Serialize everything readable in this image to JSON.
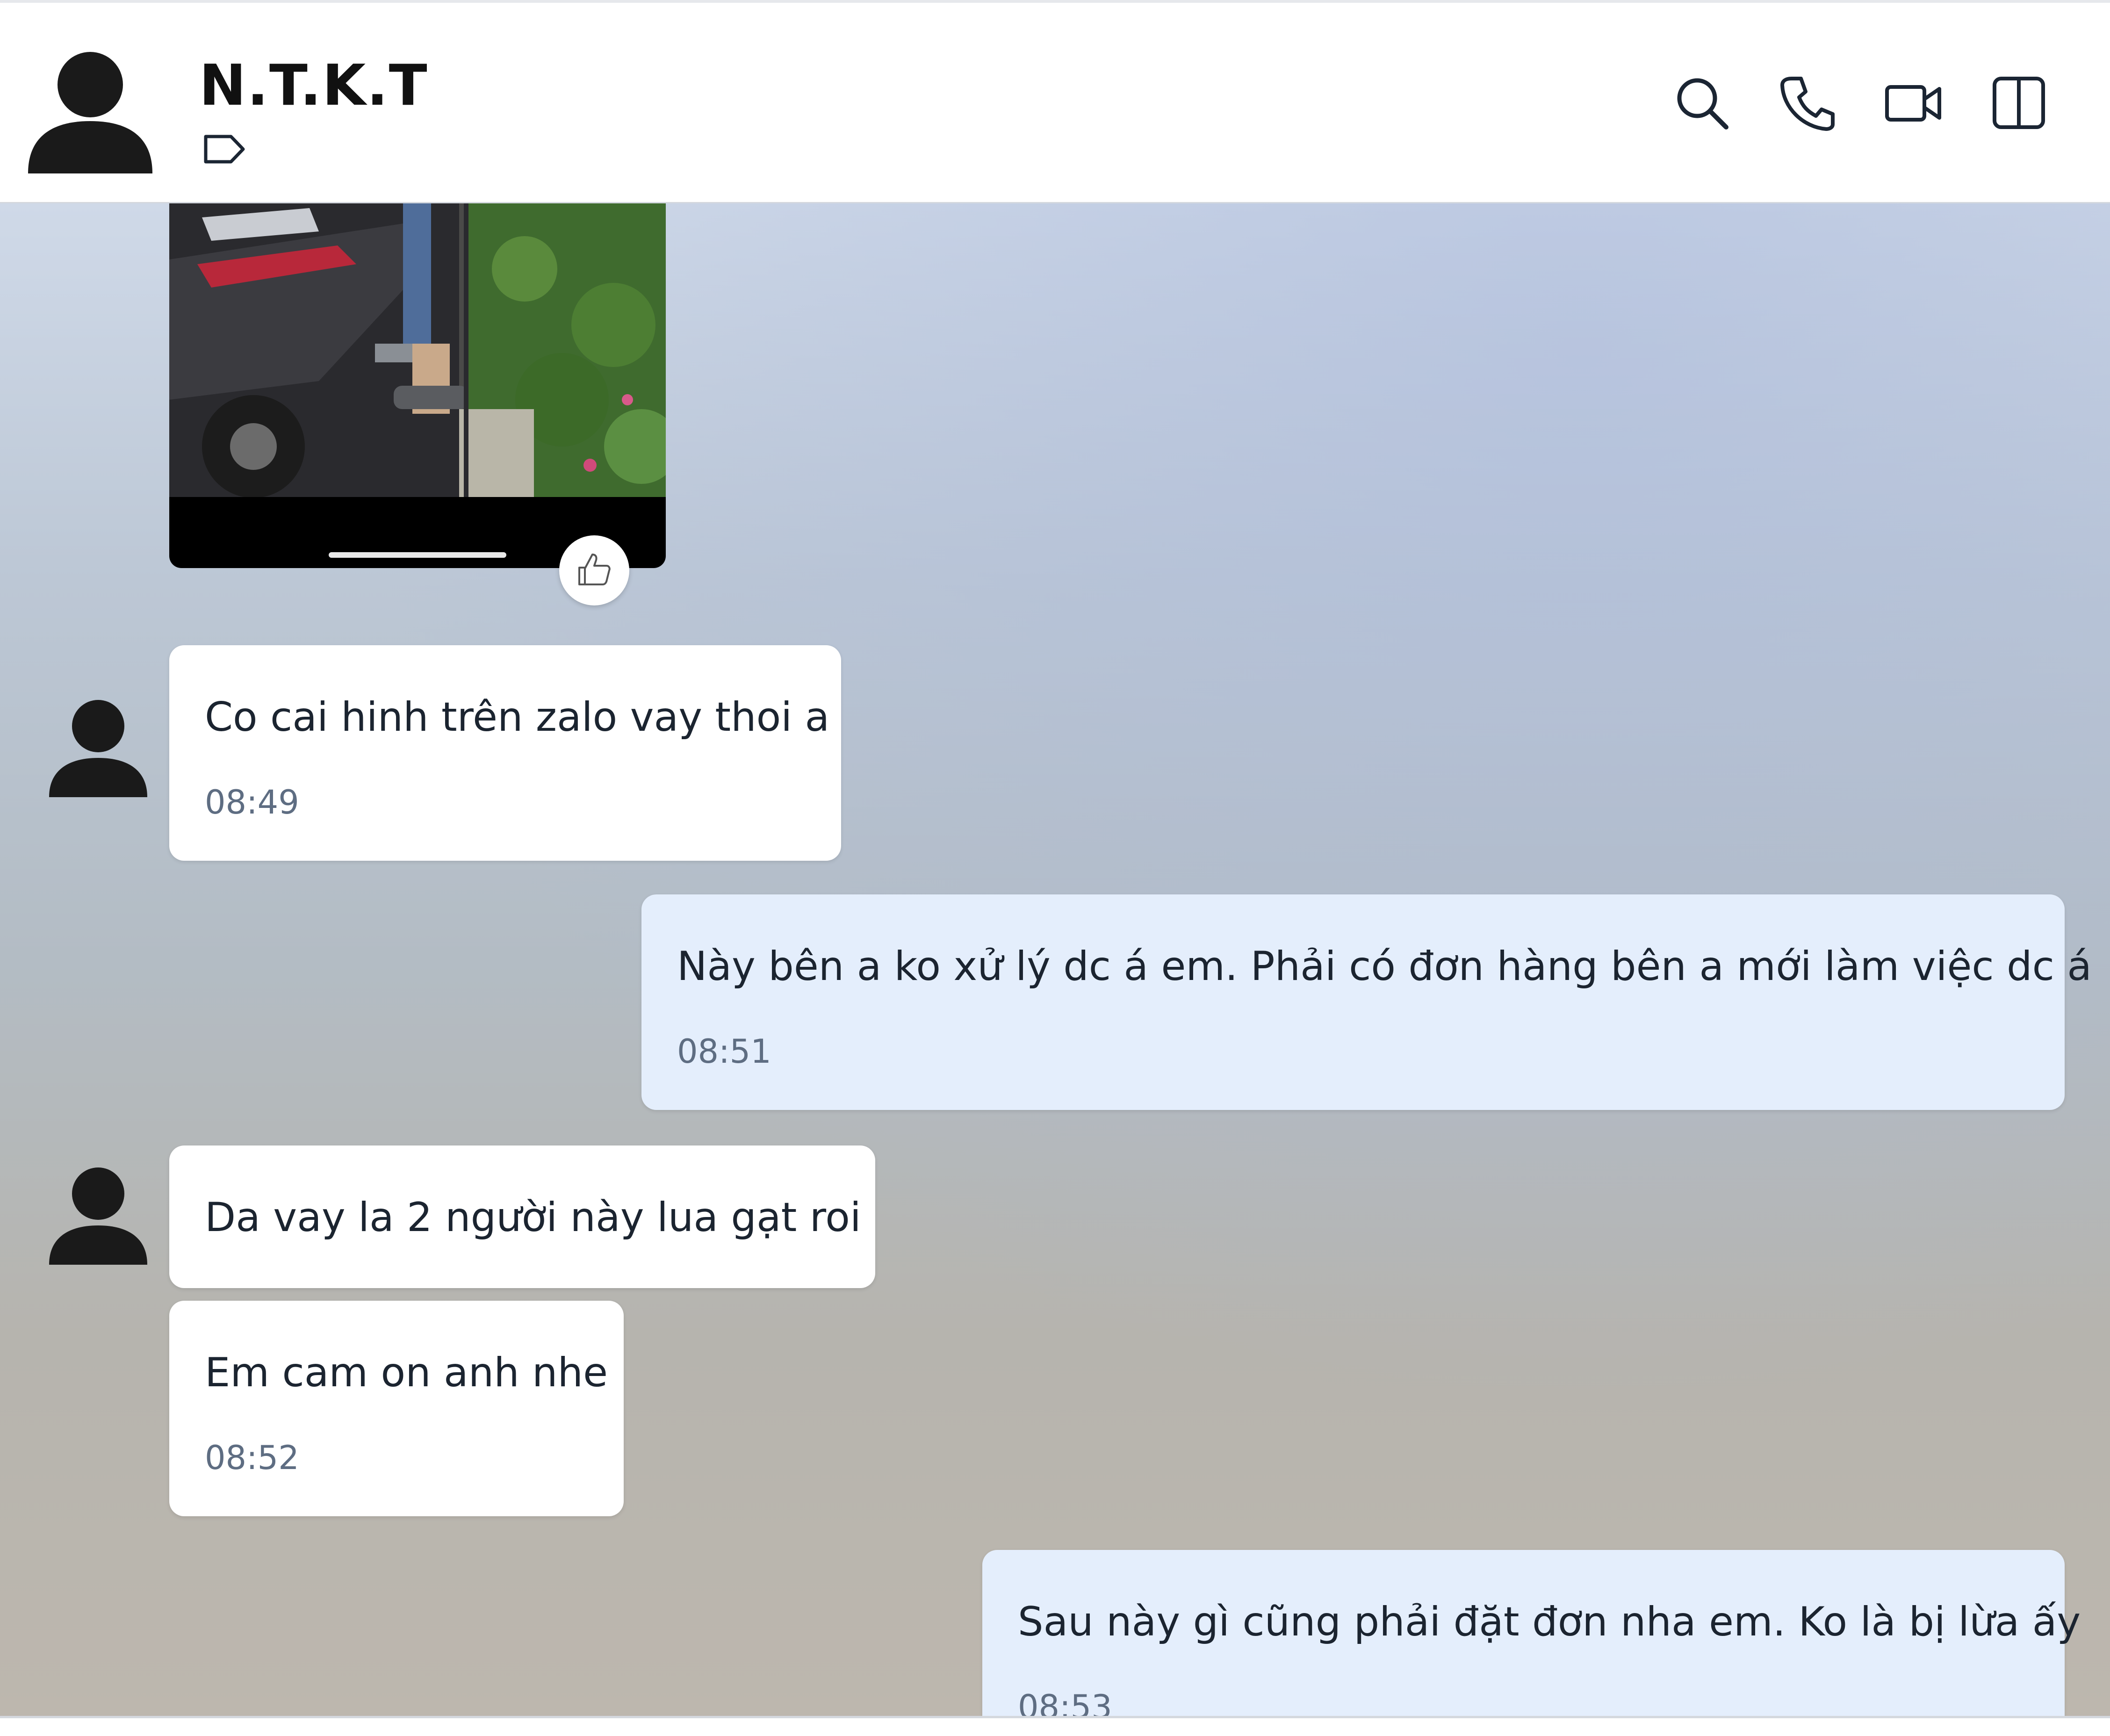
{
  "header": {
    "contact_name": "N.T.K.T",
    "icons": [
      "avatar-icon",
      "tag-icon",
      "search-icon",
      "phone-icon",
      "video-call-icon",
      "sidebar-toggle-icon"
    ]
  },
  "messages": [
    {
      "direction": "incoming",
      "text": "Co cai hinh trên zalo vay thoi a",
      "time": "08:49"
    },
    {
      "direction": "outgoing",
      "text": "Này bên a ko xử lý dc á em. Phải có đơn hàng bên a mới làm việc dc á",
      "time": "08:51"
    },
    {
      "direction": "incoming",
      "text": "Da vay la 2 người này lua gạt roi",
      "time": ""
    },
    {
      "direction": "incoming",
      "text": "Em cam on anh nhe",
      "time": "08:52"
    },
    {
      "direction": "outgoing",
      "text": "Sau này gì cũng phải đặt đơn nha em. Ko là bị lừa ấy",
      "time": "08:53"
    }
  ],
  "colors": {
    "incoming_bubble": "#ffffff",
    "outgoing_bubble": "#e4eefc",
    "timestamp": "#5e6d82",
    "icon_stroke": "#1b2533"
  }
}
